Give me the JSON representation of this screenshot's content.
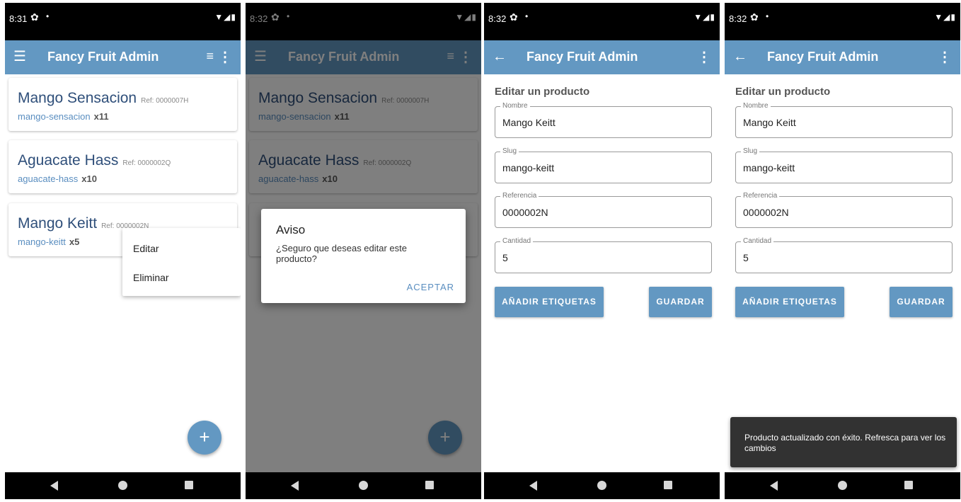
{
  "app": {
    "title": "Fancy Fruit Admin",
    "primary_color": "#6398c2"
  },
  "screens": [
    {
      "status": {
        "time": "8:31",
        "icons": [
          "gear-icon",
          "dot",
          "wifi-icon",
          "signal-icon",
          "battery-icon"
        ]
      },
      "products": [
        {
          "name": "Mango Sensacion",
          "ref": "Ref: 0000007H",
          "slug": "mango-sensacion",
          "qty": "x11"
        },
        {
          "name": "Aguacate Hass",
          "ref": "Ref: 0000002Q",
          "slug": "aguacate-hass",
          "qty": "x10"
        },
        {
          "name": "Mango Keitt",
          "ref": "Ref: 0000002N",
          "slug": "mango-keitt",
          "qty": "x5"
        }
      ],
      "context_menu": {
        "edit": "Editar",
        "delete": "Eliminar"
      },
      "fab": "+"
    },
    {
      "status": {
        "time": "8:32"
      },
      "products": [
        {
          "name": "Mango Sensacion",
          "ref": "Ref: 0000007H",
          "slug": "mango-sensacion",
          "qty": "x11"
        },
        {
          "name": "Aguacate Hass",
          "ref": "Ref: 0000002Q",
          "slug": "aguacate-hass",
          "qty": "x10"
        }
      ],
      "dialog": {
        "title": "Aviso",
        "message": "¿Seguro que deseas editar este producto?",
        "accept": "ACEPTAR"
      },
      "fab": "+"
    },
    {
      "status": {
        "time": "8:32"
      },
      "form": {
        "title": "Editar un producto",
        "fields": [
          {
            "label": "Nombre",
            "value": "Mango Keitt"
          },
          {
            "label": "Slug",
            "value": "mango-keitt"
          },
          {
            "label": "Referencia",
            "value": "0000002N"
          },
          {
            "label": "Cantidad",
            "value": "5"
          }
        ],
        "add_tags": "AÑADIR ETIQUETAS",
        "save": "GUARDAR"
      }
    },
    {
      "status": {
        "time": "8:32"
      },
      "form": {
        "title": "Editar un producto",
        "fields": [
          {
            "label": "Nombre",
            "value": "Mango Keitt"
          },
          {
            "label": "Slug",
            "value": "mango-keitt"
          },
          {
            "label": "Referencia",
            "value": "0000002N"
          },
          {
            "label": "Cantidad",
            "value": "5"
          }
        ],
        "add_tags": "AÑADIR ETIQUETAS",
        "save": "GUARDAR"
      },
      "snackbar": "Producto actualizado con éxito. Refresca para ver los cambios"
    }
  ]
}
